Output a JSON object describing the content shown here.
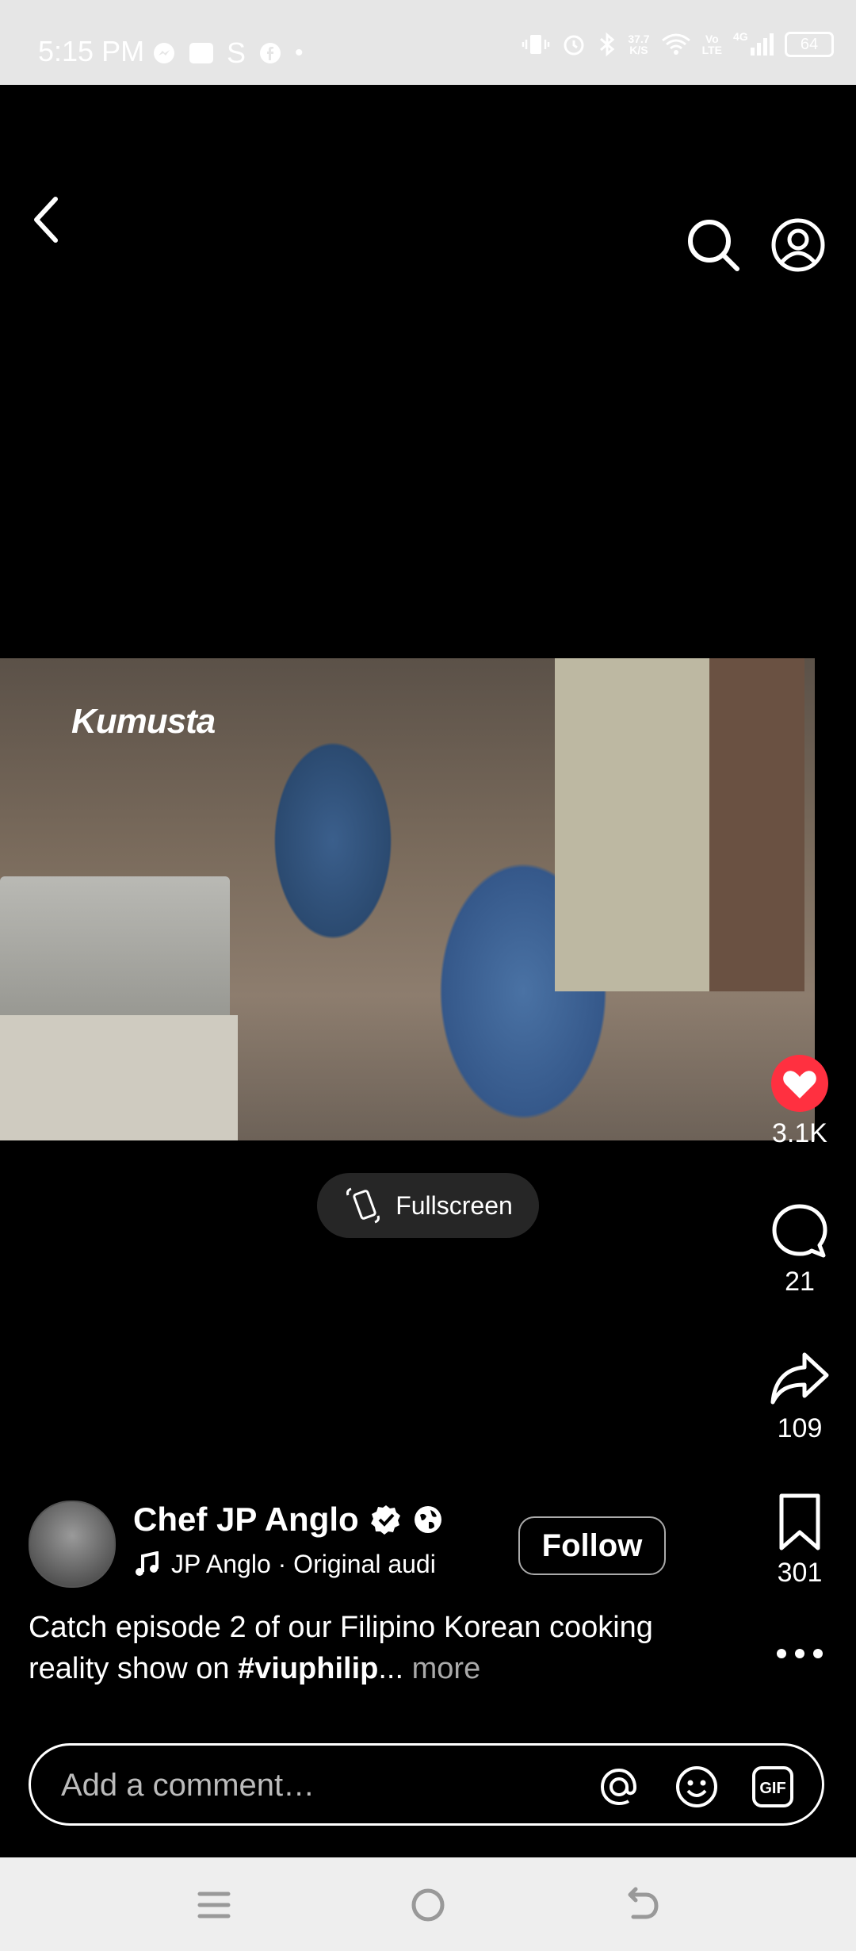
{
  "status_bar": {
    "time": "5:15 PM",
    "net_speed_top": "37.7",
    "net_speed_bottom": "K/S",
    "volte_top": "Vo",
    "volte_bottom": "LTE",
    "network": "4G",
    "battery": "64"
  },
  "video": {
    "watermark": "Kumusta"
  },
  "fullscreen": {
    "label": "Fullscreen"
  },
  "actions": {
    "likes": "3.1K",
    "comments": "21",
    "shares": "109",
    "saves": "301",
    "like_color": "#ff3040"
  },
  "author": {
    "name": "Chef JP Anglo",
    "audio": "JP Anglo · Original audi",
    "follow_label": "Follow"
  },
  "caption": {
    "text": "Catch episode 2 of our Filipino Korean cooking reality show on ",
    "hashtag": "#viuphilip",
    "ellipsis": "...",
    "more": " more"
  },
  "comment": {
    "placeholder": "Add a comment…"
  },
  "icons": [
    "back-icon",
    "search-icon",
    "profile-icon",
    "heart-icon",
    "comment-icon",
    "share-icon",
    "bookmark-icon",
    "more-icon",
    "mention-icon",
    "emoji-icon",
    "gif-icon",
    "music-icon",
    "verified-icon",
    "globe-icon",
    "fullscreen-icon"
  ]
}
